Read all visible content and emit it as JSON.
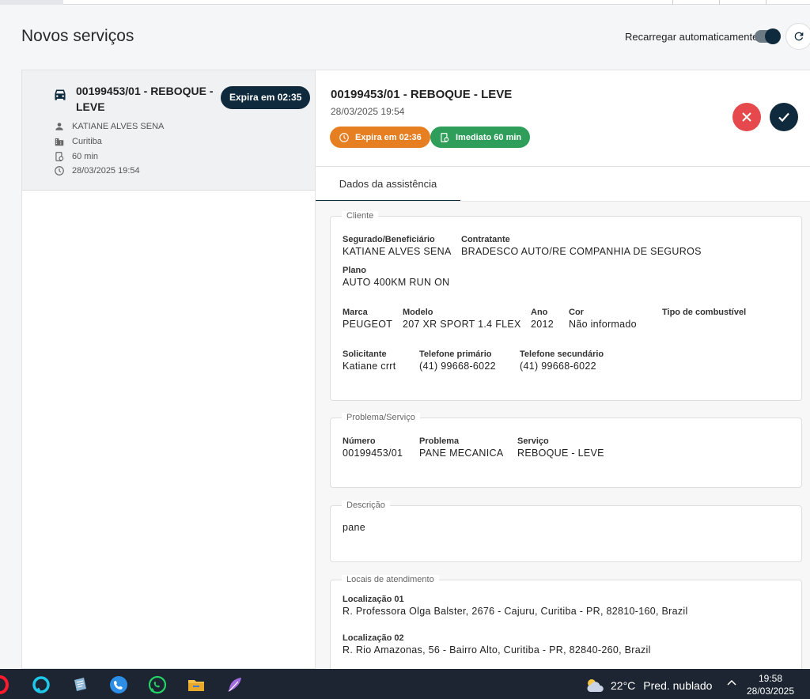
{
  "header": {
    "page_title": "Novos serviços",
    "auto_reload_label": "Recarregar automaticamente",
    "auto_reload_on": true
  },
  "service_card": {
    "title": "00199453/01 - REBOQUE - LEVE",
    "expires_badge": "Expira em 02:35",
    "customer": "KATIANE ALVES SENA",
    "city": "Curitiba",
    "duration": "60 min",
    "datetime": "28/03/2025 19:54",
    "icons": [
      "car-icon",
      "person-icon",
      "building-icon",
      "clipboard-clock-icon",
      "clock-icon"
    ]
  },
  "detail": {
    "title": "00199453/01 - REBOQUE - LEVE",
    "datetime": "28/03/2025 19:54",
    "expires_pill": "Expira em 02:36",
    "immediate_pill": "Imediato 60 min",
    "tab": "Dados da assistência",
    "colors": {
      "orange": "#e67e22",
      "green": "#2e9e5a",
      "red": "#e5484d",
      "dark": "#0f2a3d"
    }
  },
  "cliente": {
    "legend": "Cliente",
    "segurado_label": "Segurado/Beneficiário",
    "segurado": "KATIANE ALVES SENA",
    "contratante_label": "Contratante",
    "contratante": "BRADESCO AUTO/RE COMPANHIA DE SEGUROS",
    "plano_label": "Plano",
    "plano": "AUTO 400KM RUN ON",
    "marca_label": "Marca",
    "marca": "PEUGEOT",
    "modelo_label": "Modelo",
    "modelo": "207 XR SPORT 1.4 FLEX",
    "ano_label": "Ano",
    "ano": "2012",
    "cor_label": "Cor",
    "cor": "Não informado",
    "combustivel_label": "Tipo de combustível",
    "combustivel": "",
    "solicitante_label": "Solicitante",
    "solicitante": "Katiane crrt",
    "tel1_label": "Telefone primário",
    "tel1": "(41) 99668-6022",
    "tel2_label": "Telefone secundário",
    "tel2": "(41) 99668-6022"
  },
  "problema": {
    "legend": "Problema/Serviço",
    "numero_label": "Número",
    "numero": "00199453/01",
    "problema_label": "Problema",
    "problema": "PANE MECANICA",
    "servico_label": "Serviço",
    "servico": "REBOQUE - LEVE"
  },
  "descricao": {
    "legend": "Descrição",
    "text": "pane"
  },
  "locais": {
    "legend": "Locais de atendimento",
    "loc1_label": "Localização 01",
    "loc1": "R. Professora Olga Balster, 2676 - Cajuru, Curitiba - PR, 82810-160, Brazil",
    "loc2_label": "Localização 02",
    "loc2": "R. Rio Amazonas, 56 - Bairro Alto, Curitiba - PR, 82840-260, Brazil"
  },
  "taskbar": {
    "temperature": "22°C",
    "weather": "Pred. nublado",
    "time": "19:58",
    "date": "28/03/2025",
    "apps": [
      "opera-icon",
      "alexa-icon",
      "notes-icon",
      "phone-icon",
      "whatsapp-icon",
      "file-explorer-icon",
      "feather-icon"
    ]
  }
}
